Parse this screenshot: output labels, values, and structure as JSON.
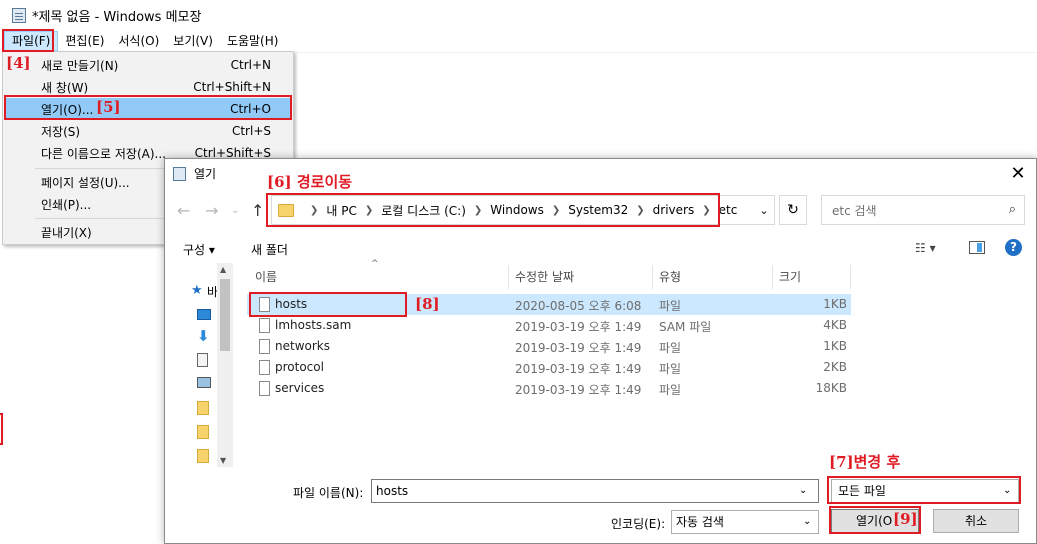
{
  "window": {
    "title": "*제목 없음 - Windows 메모장"
  },
  "menubar": [
    {
      "label": "파일(F)"
    },
    {
      "label": "편집(E)"
    },
    {
      "label": "서식(O)"
    },
    {
      "label": "보기(V)"
    },
    {
      "label": "도움말(H)"
    }
  ],
  "file_menu": {
    "items": [
      {
        "label": "새로 만들기(N)",
        "accel": "Ctrl+N"
      },
      {
        "label": "새 창(W)",
        "accel": "Ctrl+Shift+N"
      },
      {
        "label": "열기(O)...",
        "accel": "Ctrl+O"
      },
      {
        "label": "저장(S)",
        "accel": "Ctrl+S"
      },
      {
        "label": "다른 이름으로 저장(A)...",
        "accel": "Ctrl+Shift+S"
      },
      {
        "label": "페이지 설정(U)...",
        "accel": ""
      },
      {
        "label": "인쇄(P)...",
        "accel": ""
      },
      {
        "label": "끝내기(X)",
        "accel": ""
      }
    ]
  },
  "annotations": {
    "a4": "[4]",
    "a5": "[5]",
    "a6": "[6] 경로이동",
    "a7": "[7]변경 후",
    "a8": "[8]",
    "a9": "[9]"
  },
  "dialog": {
    "title": "열기",
    "close": "✕",
    "path": [
      "내 PC",
      "로컬 디스크 (C:)",
      "Windows",
      "System32",
      "drivers",
      "etc"
    ],
    "search_placeholder": "etc 검색",
    "organize": "구성 ▾",
    "new_folder": "새 폴더",
    "view": "☷ ▾",
    "help": "?",
    "nav_label": "바",
    "columns": {
      "name": "이름",
      "date": "수정한 날짜",
      "type": "유형",
      "size": "크기"
    },
    "files": [
      {
        "name": "hosts",
        "date": "2020-08-05 오후 6:08",
        "type": "파일",
        "size": "1KB"
      },
      {
        "name": "lmhosts.sam",
        "date": "2019-03-19 오후 1:49",
        "type": "SAM 파일",
        "size": "4KB"
      },
      {
        "name": "networks",
        "date": "2019-03-19 오후 1:49",
        "type": "파일",
        "size": "1KB"
      },
      {
        "name": "protocol",
        "date": "2019-03-19 오후 1:49",
        "type": "파일",
        "size": "2KB"
      },
      {
        "name": "services",
        "date": "2019-03-19 오후 1:49",
        "type": "파일",
        "size": "18KB"
      }
    ],
    "filename_label": "파일 이름(N):",
    "filename_value": "hosts",
    "filter": "모든 파일",
    "encoding_label": "인코딩(E):",
    "encoding_value": "자동 검색",
    "open_button": "열기(O",
    "cancel_button": "취소"
  },
  "colors": {
    "annotation": "#e01b24",
    "selection": "#cce8ff",
    "menu_highlight": "#91c9f7"
  }
}
